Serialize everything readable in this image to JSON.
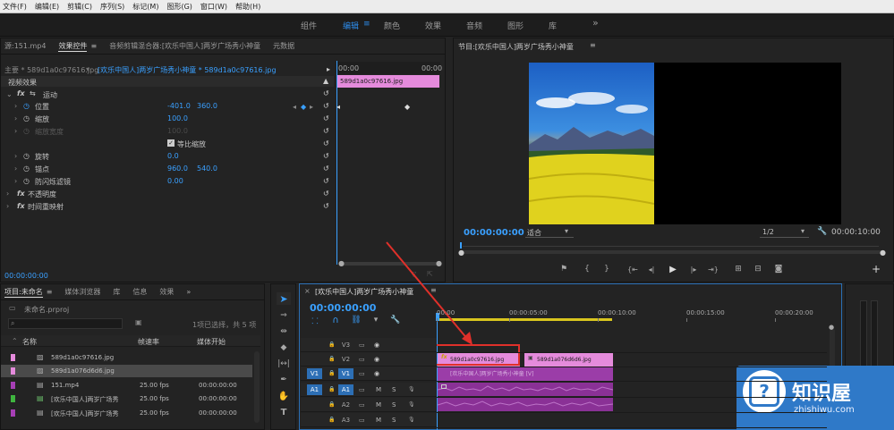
{
  "menubar": [
    "文件(F)",
    "编辑(E)",
    "剪辑(C)",
    "序列(S)",
    "标记(M)",
    "图形(G)",
    "窗口(W)",
    "帮助(H)"
  ],
  "workspaces": {
    "items": [
      "组件",
      "编辑",
      "颜色",
      "效果",
      "音频",
      "图形",
      "库"
    ],
    "active": "编辑",
    "more": "»"
  },
  "effect_controls": {
    "tabs": [
      "源:151.mp4",
      "效果控件",
      "音频剪辑混合器:[欢乐中国人]两岁广场秀小神童",
      "元数据"
    ],
    "master_label": "主要 * 589d1a0c97616.jpg",
    "clip_label": "[欢乐中国人]两岁广场秀小神童 * 589d1a0c97616.jpg",
    "mini_start": "00:00",
    "mini_end": "00:00",
    "mini_clip": "589d1a0c97616.jpg",
    "section": "视频效果",
    "motion": "运动",
    "props": [
      {
        "name": "位置",
        "v1": "-401.0",
        "v2": "360.0"
      },
      {
        "name": "缩放",
        "v1": "100.0",
        "v2": ""
      },
      {
        "name": "缩放宽度",
        "v1": "100.0",
        "v2": ""
      },
      {
        "name": "等比缩放",
        "v1": "",
        "v2": ""
      },
      {
        "name": "旋转",
        "v1": "0.0",
        "v2": ""
      },
      {
        "name": "锚点",
        "v1": "960.0",
        "v2": "540.0"
      },
      {
        "name": "防闪烁滤镜",
        "v1": "0.00",
        "v2": ""
      },
      {
        "name": "不透明度",
        "v1": "",
        "v2": ""
      },
      {
        "name": "时间重映射",
        "v1": "",
        "v2": ""
      }
    ],
    "timecode": "00:00:00:00"
  },
  "program": {
    "title": "节目:[欢乐中国人]两岁广场秀小神童",
    "timecode": "00:00:00:00",
    "fit": "适合",
    "quality": "1/2",
    "duration": "00:00:10:00"
  },
  "project": {
    "tabs": [
      "项目:未命名",
      "媒体浏览器",
      "库",
      "信息",
      "效果"
    ],
    "name": "未命名.prproj",
    "selection": "1项已选择，共 5 项",
    "headers": [
      "名称",
      "帧速率",
      "媒体开始"
    ],
    "rows": [
      {
        "name": "589d1a0c97616.jpg",
        "rate": "",
        "start": "",
        "color": "#e58bdc"
      },
      {
        "name": "589d1a076d6d6.jpg",
        "rate": "",
        "start": "",
        "color": "#e58bdc"
      },
      {
        "name": "151.mp4",
        "rate": "25.00 fps",
        "start": "00:00:00:00",
        "color": "#a63fb5"
      },
      {
        "name": "[欢乐中国人]两岁广场秀",
        "rate": "25.00 fps",
        "start": "00:00:00:00",
        "color": "#3fb53f"
      },
      {
        "name": "[欢乐中国人]两岁广场秀",
        "rate": "25.00 fps",
        "start": "00:00:00:00",
        "color": "#a63fb5"
      }
    ]
  },
  "timeline": {
    "title": "[欢乐中国人]两岁广场秀小神童",
    "timecode": "00:00:00:00",
    "ruler": [
      "00:00",
      "00:00:05:00",
      "00:00:10:00",
      "00:00:15:00",
      "00:00:20:00"
    ],
    "tracks": [
      "V3",
      "V2",
      "V1",
      "A1",
      "A2",
      "A3"
    ],
    "src_v": "V1",
    "src_a": "A1",
    "clips": {
      "v2a": "589d1a0c97616.jpg",
      "v2b": "589d1a076d6d6.jpg",
      "v1": "[欢乐中国人]两岁广场秀小神童 [V]"
    },
    "audio_m": "M",
    "audio_s": "S"
  },
  "watermark": {
    "title": "知识屋",
    "url": "zhishiwu.com"
  },
  "colors": {
    "accent": "#2d8ceb",
    "clip_pink": "#e58bdc",
    "clip_purple": "#a63fb5",
    "highlight": "#e0302a"
  }
}
